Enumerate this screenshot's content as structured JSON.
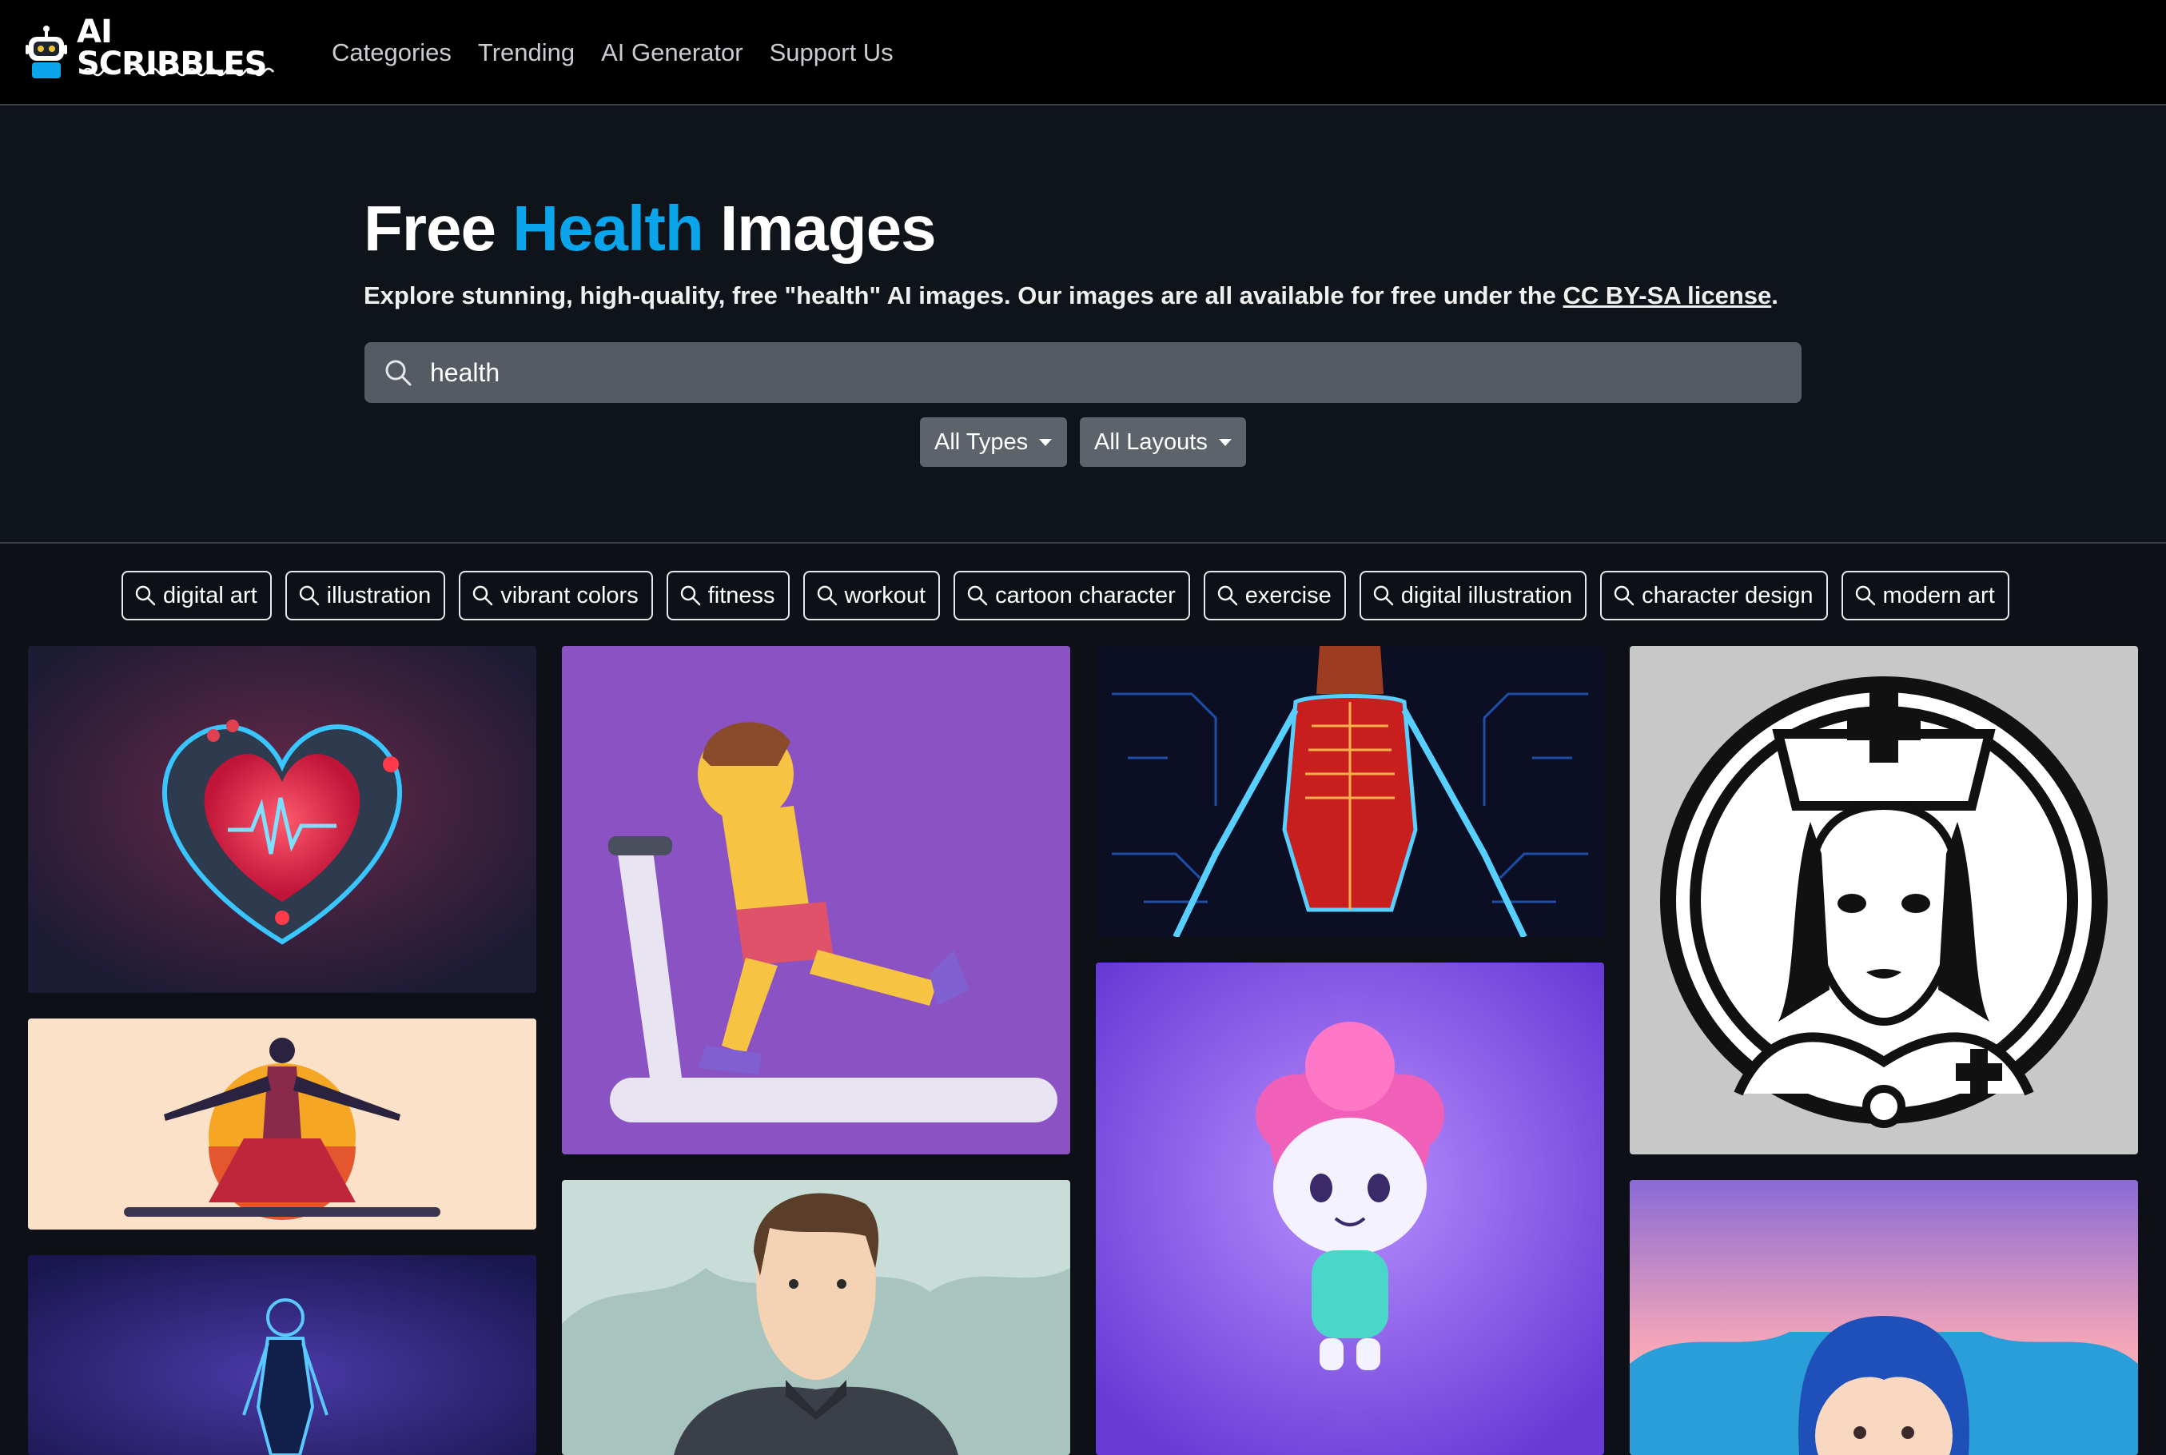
{
  "brand": {
    "name": "AI SCRIBBLES"
  },
  "nav": {
    "items": [
      "Categories",
      "Trending",
      "AI Generator",
      "Support Us"
    ]
  },
  "hero": {
    "title_prefix": "Free ",
    "title_accent": "Health",
    "title_suffix": " Images",
    "subtitle_text": "Explore stunning, high-quality, free \"health\" AI images. Our images are all available for free under the ",
    "subtitle_link": "CC BY-SA license",
    "subtitle_end": "."
  },
  "search": {
    "value": "health",
    "icon": "search-icon"
  },
  "filters": {
    "types": "All Types",
    "layouts": "All Layouts"
  },
  "tags": [
    "digital art",
    "illustration",
    "vibrant colors",
    "fitness",
    "workout",
    "cartoon character",
    "exercise",
    "digital illustration",
    "character design",
    "modern art"
  ],
  "colors": {
    "accent": "#0aa5ea",
    "background": "#0d1117",
    "navbar": "#000000",
    "search_bg": "#555b63",
    "dropdown_bg": "#5c636a"
  },
  "images": [
    {
      "name": "heart-monitor-image",
      "subject": "glowing heart with heartbeat line"
    },
    {
      "name": "treadmill-runner-image",
      "subject": "cartoon man running on treadmill"
    },
    {
      "name": "neon-skeleton-image",
      "subject": "neon anatomy skeleton on circuit background"
    },
    {
      "name": "nurse-icon-image",
      "subject": "black and white nurse emblem"
    },
    {
      "name": "yoga-pose-image",
      "subject": "woman in yoga pose with sunset"
    },
    {
      "name": "cute-brain-character-image",
      "subject": "cute character with pink brain head"
    },
    {
      "name": "man-portrait-image",
      "subject": "illustrated man in athletic shirt"
    },
    {
      "name": "blue-body-image",
      "subject": "glowing blue human body"
    },
    {
      "name": "blue-hair-child-image",
      "subject": "child with blue hair"
    }
  ]
}
